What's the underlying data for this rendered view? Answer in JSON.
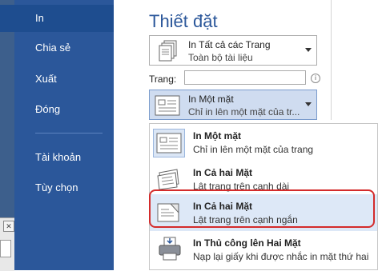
{
  "sidebar": {
    "items": [
      {
        "label": "In"
      },
      {
        "label": "Chia sẻ"
      },
      {
        "label": "Xuất"
      },
      {
        "label": "Đóng"
      },
      {
        "label": "Tài khoản"
      },
      {
        "label": "Tùy chọn"
      }
    ],
    "active_index": 0
  },
  "main": {
    "title": "Thiết đặt",
    "print_range": {
      "main": "In Tất cả các Trang",
      "sub": "Toàn bộ tài liệu"
    },
    "pages_label": "Trang:",
    "pages_value": "",
    "sides": {
      "main": "In Một mặt",
      "sub": "Chỉ in lên một mặt của tr..."
    }
  },
  "menu": {
    "items": [
      {
        "title": "In Một mặt",
        "desc": "Chỉ in lên một mặt của trang",
        "icon": "one-sided-page-icon"
      },
      {
        "title": "In Cả hai Mặt",
        "desc": "Lật trang trên cạnh dài",
        "icon": "flip-long-edge-icon"
      },
      {
        "title": "In Cả hai Mặt",
        "desc": "Lật trang trên cạnh ngắn",
        "icon": "flip-short-edge-icon"
      },
      {
        "title": "In Thủ công lên Hai Mặt",
        "desc": "Nạp lại giấy khi được nhắc in mặt thứ hai",
        "icon": "manual-duplex-printer-icon"
      }
    ],
    "highlighted_index": 2
  },
  "colors": {
    "accent": "#2b579a",
    "sidebar": "#2b579a",
    "active": "#1e4d8f",
    "highlight_ring": "#d42b2b"
  }
}
